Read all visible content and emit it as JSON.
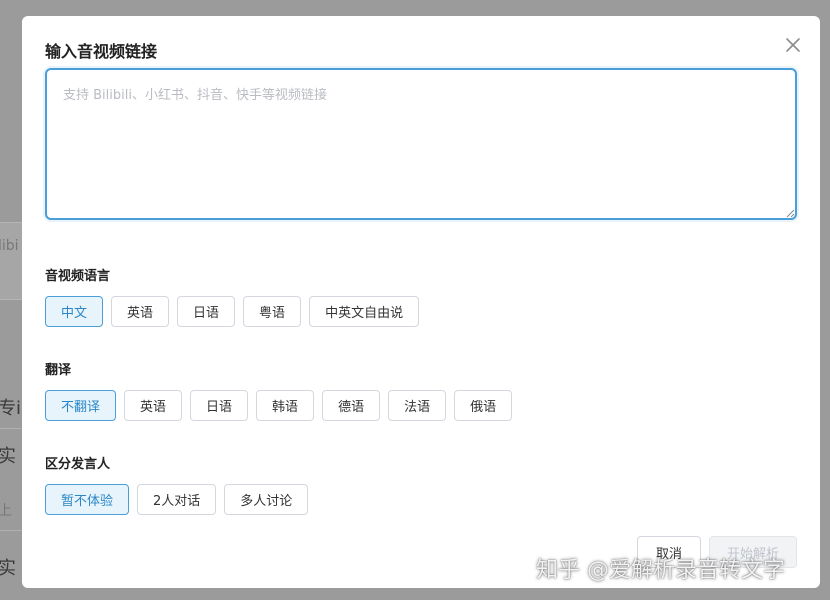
{
  "background": {
    "fragments": [
      "libi",
      "专i",
      "实",
      "上",
      "实"
    ]
  },
  "dialog": {
    "title": "输入音视频链接",
    "close_icon": "close-icon",
    "link_input": {
      "value": "",
      "placeholder": "支持 Bilibili、小红书、抖音、快手等视频链接"
    },
    "language_section": {
      "label": "音视频语言",
      "options": [
        "中文",
        "英语",
        "日语",
        "粤语",
        "中英文自由说"
      ],
      "selected": "中文"
    },
    "translate_section": {
      "label": "翻译",
      "options": [
        "不翻译",
        "英语",
        "日语",
        "韩语",
        "德语",
        "法语",
        "俄语"
      ],
      "selected": "不翻译"
    },
    "speaker_section": {
      "label": "区分发言人",
      "options": [
        "暂不体验",
        "2人对话",
        "多人讨论"
      ],
      "selected": "暂不体验"
    },
    "footer": {
      "cancel_label": "取消",
      "start_label": "开始解析"
    }
  },
  "watermark": "知乎 @爱解析录音转文字",
  "colors": {
    "accent": "#4a9fd8",
    "selected_bg": "#e8f4fb",
    "disabled_text": "#c0c4cc"
  }
}
